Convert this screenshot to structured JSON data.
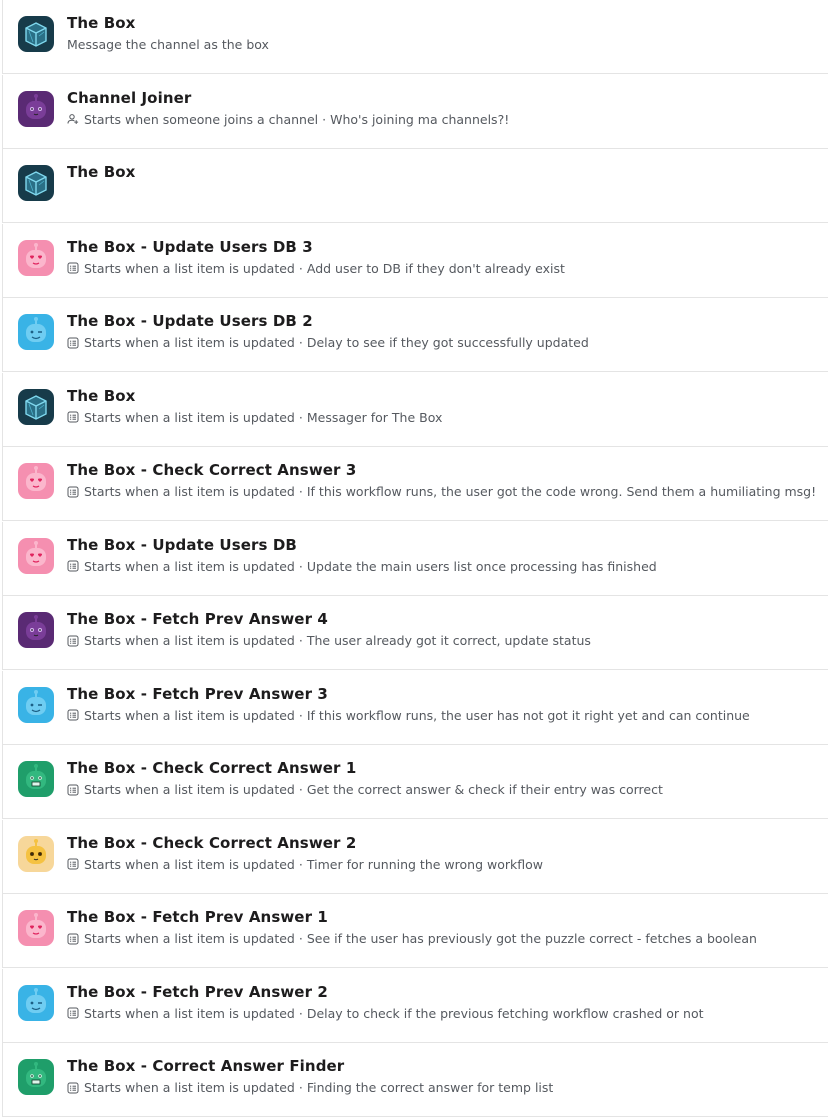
{
  "workflows": [
    {
      "title": "The Box",
      "avatar": "box-icon",
      "trigger_icon": "",
      "trigger": "",
      "description": "Message the channel as the box"
    },
    {
      "title": "Channel Joiner",
      "avatar": "robot-purple-icon",
      "trigger_icon": "person-add-icon",
      "trigger": "Starts when someone joins a channel",
      "description": "Who's joining ma channels?!"
    },
    {
      "title": "The Box",
      "avatar": "box-icon",
      "trigger_icon": "",
      "trigger": "",
      "description": ""
    },
    {
      "title": "The Box - Update Users DB 3",
      "avatar": "robot-pink-icon",
      "trigger_icon": "list-icon",
      "trigger": "Starts when a list item is updated",
      "description": "Add user to DB if they don't already exist"
    },
    {
      "title": "The Box - Update Users DB 2",
      "avatar": "robot-blue-icon",
      "trigger_icon": "list-icon",
      "trigger": "Starts when a list item is updated",
      "description": "Delay to see if they got successfully updated"
    },
    {
      "title": "The Box",
      "avatar": "box-icon",
      "trigger_icon": "list-icon",
      "trigger": "Starts when a list item is updated",
      "description": "Messager for The Box"
    },
    {
      "title": "The Box - Check Correct Answer 3",
      "avatar": "robot-pink-icon",
      "trigger_icon": "list-icon",
      "trigger": "Starts when a list item is updated",
      "description": "If this workflow runs, the user got the code wrong. Send them a humiliating msg!"
    },
    {
      "title": "The Box - Update Users DB",
      "avatar": "robot-pink-icon",
      "trigger_icon": "list-icon",
      "trigger": "Starts when a list item is updated",
      "description": "Update the main users list once processing has finished"
    },
    {
      "title": "The Box - Fetch Prev Answer 4",
      "avatar": "robot-purple-icon",
      "trigger_icon": "list-icon",
      "trigger": "Starts when a list item is updated",
      "description": "The user already got it correct, update status"
    },
    {
      "title": "The Box - Fetch Prev Answer 3",
      "avatar": "robot-blue-icon",
      "trigger_icon": "list-icon",
      "trigger": "Starts when a list item is updated",
      "description": "If this workflow runs, the user has not got it right yet and can continue"
    },
    {
      "title": "The Box - Check Correct Answer 1",
      "avatar": "robot-green-icon",
      "trigger_icon": "list-icon",
      "trigger": "Starts when a list item is updated",
      "description": "Get the correct answer & check if their entry was correct"
    },
    {
      "title": "The Box - Check Correct Answer 2",
      "avatar": "robot-yellow-icon",
      "trigger_icon": "list-icon",
      "trigger": "Starts when a list item is updated",
      "description": "Timer for running the wrong workflow"
    },
    {
      "title": "The Box - Fetch Prev Answer 1",
      "avatar": "robot-pink-icon",
      "trigger_icon": "list-icon",
      "trigger": "Starts when a list item is updated",
      "description": "See if the user has previously got the puzzle correct - fetches a boolean"
    },
    {
      "title": "The Box - Fetch Prev Answer 2",
      "avatar": "robot-blue-icon",
      "trigger_icon": "list-icon",
      "trigger": "Starts when a list item is updated",
      "description": "Delay to check if the previous fetching workflow crashed or not"
    },
    {
      "title": "The Box - Correct Answer Finder",
      "avatar": "robot-green-icon",
      "trigger_icon": "list-icon",
      "trigger": "Starts when a list item is updated",
      "description": "Finding the correct answer for temp list"
    }
  ],
  "theme": {
    "box": "#173b4a",
    "robot-purple": "#5a2a74",
    "robot-pink": "#f58fb0",
    "robot-blue": "#39b3e6",
    "robot-green": "#1f9e6a",
    "robot-yellow": "#f7d79a"
  }
}
